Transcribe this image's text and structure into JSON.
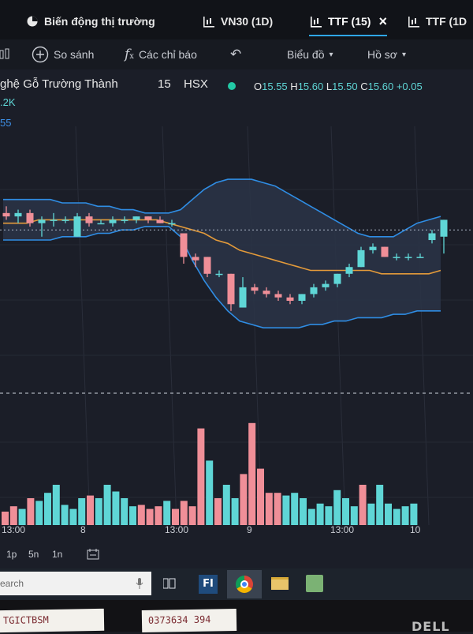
{
  "tabs": [
    {
      "label": "Biến động thị trường",
      "icon": "pie-chart-icon"
    },
    {
      "label": "VN30 (1D)",
      "icon": "candle-chart-icon"
    },
    {
      "label": "TTF (15)",
      "icon": "candle-chart-icon",
      "close": "×",
      "active": true
    },
    {
      "label": "TTF (1D",
      "icon": "candle-chart-icon"
    }
  ],
  "toolbar": {
    "compare_label": "So sánh",
    "indicators_label": "Các chỉ báo",
    "chart_label": "Biểu đồ",
    "profile_label": "Hồ sơ"
  },
  "symbol": {
    "name": "ghệ Gỗ Trường Thành",
    "interval": "15",
    "exchange": "HSX",
    "o_label": "O",
    "o_value": "15.55",
    "h_label": "H",
    "h_value": "15.60",
    "l_label": "L",
    "l_value": "15.50",
    "c_label": "C",
    "c_value": "15.60",
    "change": "+0.05",
    "volume_partial": ".2K",
    "indicator_partial": "55"
  },
  "colors": {
    "up": "#5fd6d6",
    "down": "#f08f98",
    "bands": "#2f8de4",
    "ma": "#e39a3a",
    "live_dot": "#22c9a5"
  },
  "time_axis": [
    "13:00",
    "8",
    "13:00",
    "9",
    "13:00",
    "10"
  ],
  "range_buttons": [
    "1p",
    "5n",
    "1n"
  ],
  "taskbar": {
    "search_placeholder": "earch"
  },
  "stickers": [
    "TGICTBSM",
    "0373634 394"
  ],
  "chart_data": {
    "type": "candlestick",
    "x_ticks": [
      "13:00",
      "8",
      "13:00",
      "9",
      "13:00",
      "10"
    ],
    "candles": [
      {
        "o": 15.62,
        "h": 15.64,
        "l": 15.6,
        "c": 15.61
      },
      {
        "o": 15.61,
        "h": 15.63,
        "l": 15.59,
        "c": 15.62
      },
      {
        "o": 15.62,
        "h": 15.63,
        "l": 15.58,
        "c": 15.59
      },
      {
        "o": 15.59,
        "h": 15.61,
        "l": 15.55,
        "c": 15.6
      },
      {
        "o": 15.6,
        "h": 15.62,
        "l": 15.58,
        "c": 15.6
      },
      {
        "o": 15.6,
        "h": 15.61,
        "l": 15.59,
        "c": 15.6
      },
      {
        "o": 15.55,
        "h": 15.62,
        "l": 15.55,
        "c": 15.61
      },
      {
        "o": 15.61,
        "h": 15.62,
        "l": 15.58,
        "c": 15.59
      },
      {
        "o": 15.59,
        "h": 15.6,
        "l": 15.59,
        "c": 15.59
      },
      {
        "o": 15.59,
        "h": 15.61,
        "l": 15.58,
        "c": 15.6
      },
      {
        "o": 15.6,
        "h": 15.61,
        "l": 15.59,
        "c": 15.6
      },
      {
        "o": 15.6,
        "h": 15.61,
        "l": 15.59,
        "c": 15.61
      },
      {
        "o": 15.61,
        "h": 15.61,
        "l": 15.59,
        "c": 15.6
      },
      {
        "o": 15.6,
        "h": 15.61,
        "l": 15.59,
        "c": 15.59
      },
      {
        "o": 15.59,
        "h": 15.6,
        "l": 15.58,
        "c": 15.59
      },
      {
        "o": 15.56,
        "h": 15.56,
        "l": 15.47,
        "c": 15.49
      },
      {
        "o": 15.49,
        "h": 15.5,
        "l": 15.46,
        "c": 15.48
      },
      {
        "o": 15.49,
        "h": 15.49,
        "l": 15.43,
        "c": 15.44
      },
      {
        "o": 15.44,
        "h": 15.45,
        "l": 15.43,
        "c": 15.44
      },
      {
        "o": 15.44,
        "h": 15.44,
        "l": 15.33,
        "c": 15.35
      },
      {
        "o": 15.34,
        "h": 15.43,
        "l": 15.34,
        "c": 15.4
      },
      {
        "o": 15.4,
        "h": 15.41,
        "l": 15.38,
        "c": 15.39
      },
      {
        "o": 15.39,
        "h": 15.4,
        "l": 15.37,
        "c": 15.38
      },
      {
        "o": 15.38,
        "h": 15.39,
        "l": 15.36,
        "c": 15.37
      },
      {
        "o": 15.37,
        "h": 15.38,
        "l": 15.35,
        "c": 15.36
      },
      {
        "o": 15.36,
        "h": 15.38,
        "l": 15.35,
        "c": 15.38
      },
      {
        "o": 15.38,
        "h": 15.41,
        "l": 15.37,
        "c": 15.4
      },
      {
        "o": 15.4,
        "h": 15.42,
        "l": 15.39,
        "c": 15.41
      },
      {
        "o": 15.41,
        "h": 15.44,
        "l": 15.4,
        "c": 15.44
      },
      {
        "o": 15.44,
        "h": 15.47,
        "l": 15.43,
        "c": 15.46
      },
      {
        "o": 15.46,
        "h": 15.52,
        "l": 15.46,
        "c": 15.51
      },
      {
        "o": 15.51,
        "h": 15.53,
        "l": 15.5,
        "c": 15.52
      },
      {
        "o": 15.52,
        "h": 15.52,
        "l": 15.49,
        "c": 15.49
      },
      {
        "o": 15.49,
        "h": 15.5,
        "l": 15.48,
        "c": 15.49
      },
      {
        "o": 15.49,
        "h": 15.5,
        "l": 15.48,
        "c": 15.49
      },
      {
        "o": 15.49,
        "h": 15.5,
        "l": 15.49,
        "c": 15.49
      },
      {
        "o": 15.54,
        "h": 15.57,
        "l": 15.53,
        "c": 15.56
      },
      {
        "o": 15.55,
        "h": 15.6,
        "l": 15.5,
        "c": 15.6
      }
    ],
    "upper_band": [
      15.66,
      15.66,
      15.66,
      15.66,
      15.66,
      15.65,
      15.65,
      15.65,
      15.64,
      15.64,
      15.63,
      15.63,
      15.62,
      15.62,
      15.62,
      15.63,
      15.66,
      15.69,
      15.71,
      15.72,
      15.72,
      15.72,
      15.71,
      15.7,
      15.68,
      15.66,
      15.64,
      15.62,
      15.6,
      15.58,
      15.56,
      15.55,
      15.55,
      15.55,
      15.57,
      15.59,
      15.6,
      15.61
    ],
    "lower_band": [
      15.54,
      15.54,
      15.54,
      15.54,
      15.54,
      15.55,
      15.55,
      15.55,
      15.56,
      15.56,
      15.57,
      15.57,
      15.58,
      15.58,
      15.58,
      15.55,
      15.48,
      15.42,
      15.37,
      15.33,
      15.3,
      15.29,
      15.28,
      15.28,
      15.28,
      15.28,
      15.29,
      15.29,
      15.3,
      15.3,
      15.31,
      15.31,
      15.31,
      15.32,
      15.32,
      15.33,
      15.33,
      15.33
    ],
    "moving_average": [
      15.59,
      15.59,
      15.59,
      15.6,
      15.6,
      15.6,
      15.6,
      15.6,
      15.6,
      15.6,
      15.6,
      15.6,
      15.6,
      15.6,
      15.59,
      15.58,
      15.57,
      15.56,
      15.54,
      15.53,
      15.51,
      15.5,
      15.49,
      15.48,
      15.47,
      15.46,
      15.45,
      15.45,
      15.45,
      15.45,
      15.45,
      15.45,
      15.44,
      15.44,
      15.44,
      15.44,
      15.44,
      15.45
    ],
    "dashed_line_price": 15.57,
    "volume": [
      10,
      14,
      12,
      20,
      18,
      24,
      30,
      15,
      12,
      20,
      22,
      20,
      30,
      25,
      20,
      14,
      15,
      12,
      14,
      18,
      12,
      18,
      14,
      72,
      48,
      20,
      30,
      20,
      38,
      76,
      42,
      24,
      24,
      22,
      24,
      20,
      12,
      16,
      14,
      26,
      20,
      14,
      30,
      16,
      30,
      16,
      12,
      14,
      16
    ]
  }
}
